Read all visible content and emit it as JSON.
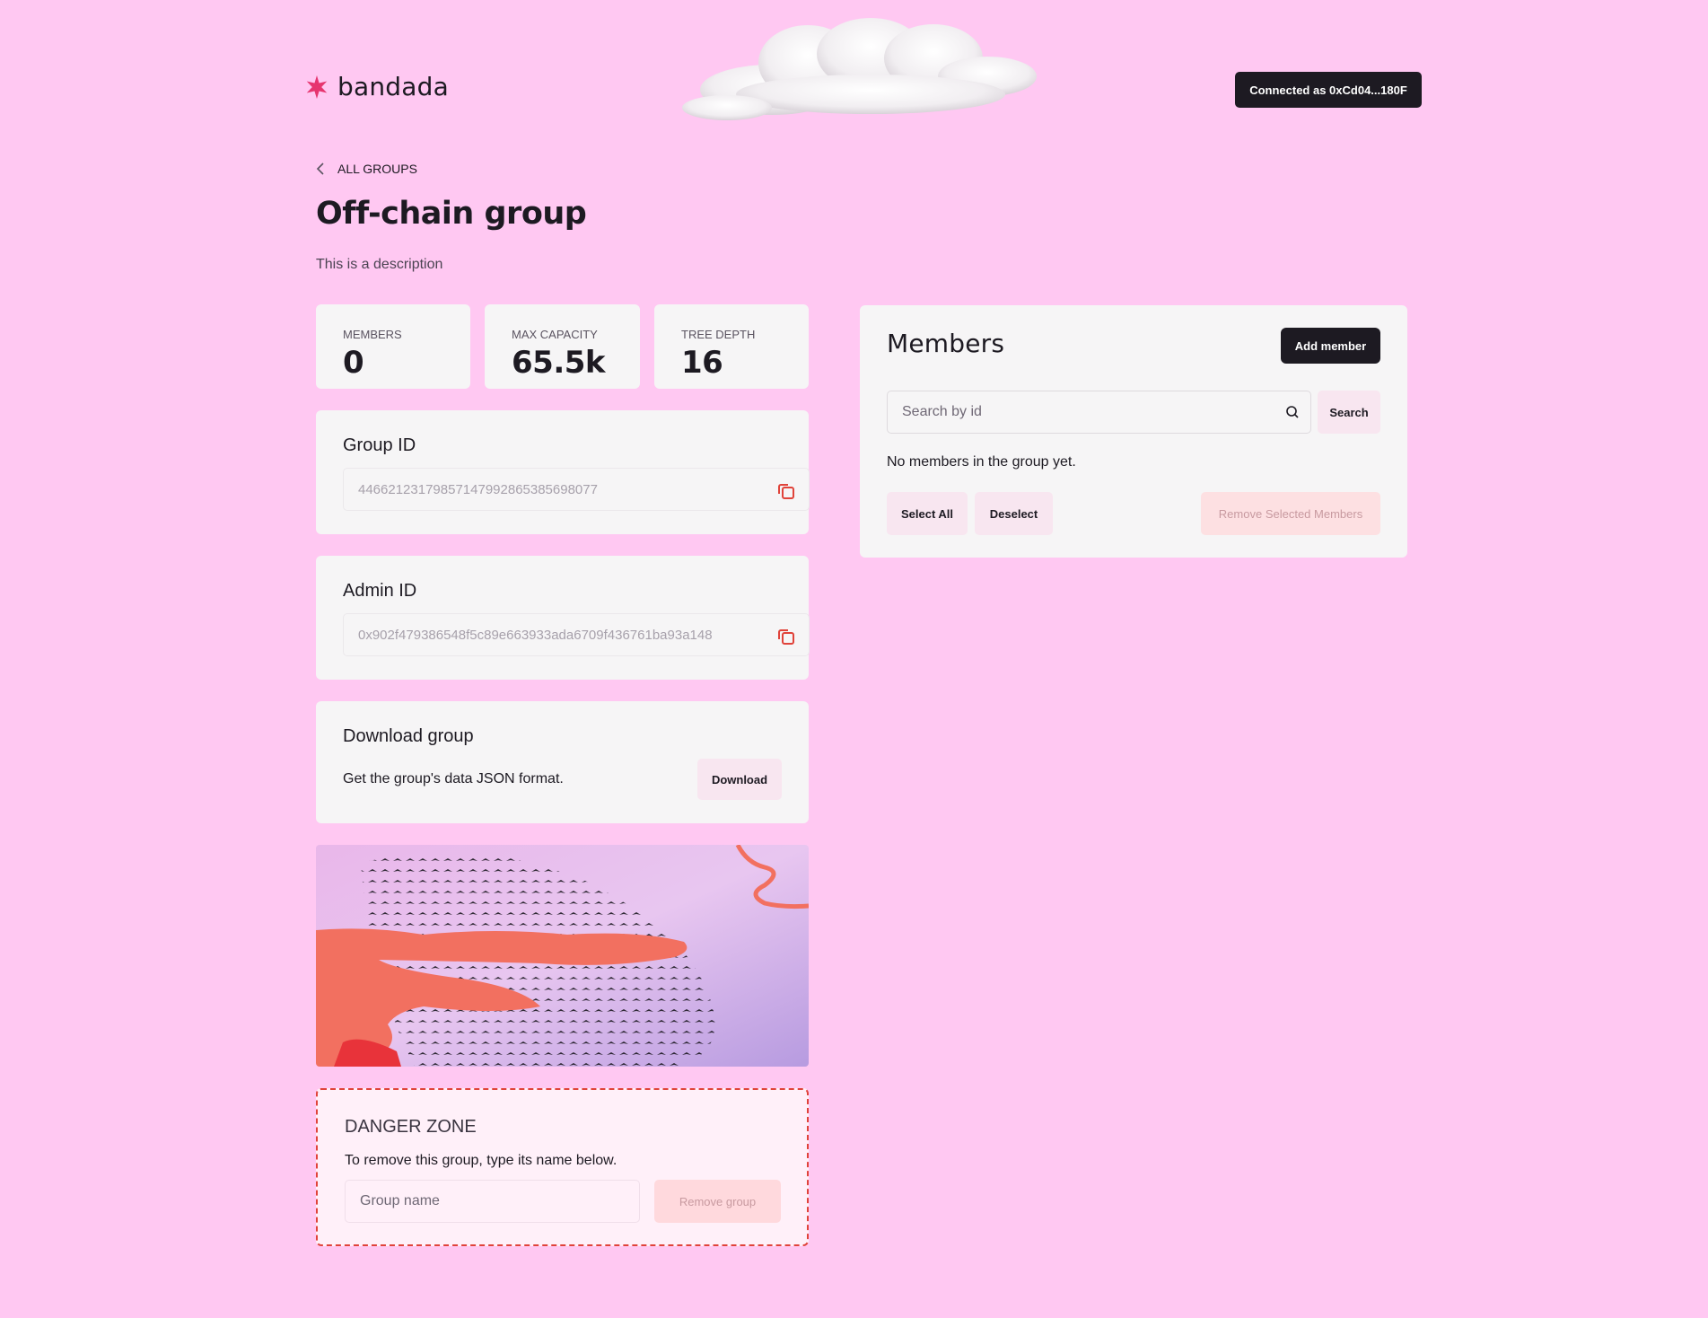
{
  "header": {
    "logo_text": "bandada",
    "connected_label": "Connected as 0xCd04...180F"
  },
  "nav": {
    "back_label": "ALL GROUPS"
  },
  "group": {
    "title": "Off-chain group",
    "description": "This is a description"
  },
  "stats": [
    {
      "label": "MEMBERS",
      "value": "0"
    },
    {
      "label": "MAX CAPACITY",
      "value": "65.5k"
    },
    {
      "label": "TREE DEPTH",
      "value": "16"
    }
  ],
  "group_id": {
    "title": "Group ID",
    "value": "44662123179857147992865385698077"
  },
  "admin_id": {
    "title": "Admin ID",
    "value": "0x902f479386548f5c89e663933ada6709f436761ba93a148"
  },
  "download": {
    "title": "Download group",
    "text": "Get the group's data JSON format.",
    "button_label": "Download"
  },
  "danger_zone": {
    "title": "DANGER ZONE",
    "text": "To remove this group, type its name below.",
    "input_placeholder": "Group name",
    "button_label": "Remove group"
  },
  "members": {
    "title": "Members",
    "add_button_label": "Add member",
    "search_placeholder": "Search by id",
    "search_button_label": "Search",
    "empty_text": "No members in the group yet.",
    "select_all_label": "Select All",
    "deselect_label": "Deselect",
    "remove_selected_label": "Remove Selected Members"
  },
  "colors": {
    "background": "#ffc8f2",
    "card": "#f6f5f6",
    "dark": "#1d1a22",
    "accent": "#e0433a",
    "logo": "#e6356f"
  }
}
